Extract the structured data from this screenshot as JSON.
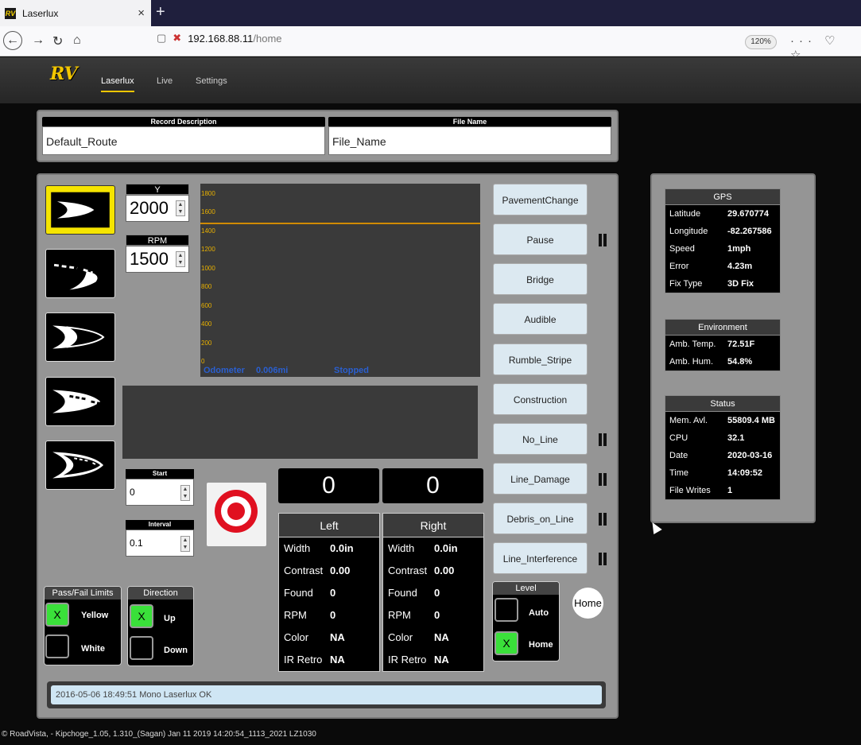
{
  "browser": {
    "tab_title": "Laserlux",
    "tab_close": "×",
    "new_tab": "+",
    "url_host": "192.168.88.11",
    "url_path": "/home",
    "zoom": "120%",
    "more_icon": "···"
  },
  "nav": {
    "logo": "RV",
    "links": [
      "Laserlux",
      "Live",
      "Settings"
    ]
  },
  "record": {
    "desc_label": "Record Description",
    "desc_value": "Default_Route",
    "file_label": "File Name",
    "file_value": "File_Name"
  },
  "controls": {
    "y_label": "Y",
    "y_value": "2000",
    "rpm_label": "RPM",
    "rpm_value": "1500",
    "start_label": "Start",
    "start_value": "0",
    "interval_label": "Interval",
    "interval_value": "0.1"
  },
  "chart_data": {
    "type": "line",
    "yticks": [
      "1800",
      "1600",
      "1400",
      "1200",
      "1000",
      "800",
      "600",
      "400",
      "200",
      "0"
    ],
    "ylim": [
      0,
      1800
    ],
    "threshold": 1500,
    "odometer_label": "Odometer",
    "odometer_value": "0.006mi",
    "state": "Stopped"
  },
  "counts": {
    "left": "0",
    "right": "0"
  },
  "left_stats": {
    "title": "Left",
    "rows": [
      {
        "k": "Width",
        "v": "0.0in"
      },
      {
        "k": "Contrast",
        "v": "0.00"
      },
      {
        "k": "Found",
        "v": "0"
      },
      {
        "k": "RPM",
        "v": "0"
      },
      {
        "k": "Color",
        "v": "NA"
      },
      {
        "k": "IR Retro",
        "v": "NA"
      }
    ]
  },
  "right_stats": {
    "title": "Right",
    "rows": [
      {
        "k": "Width",
        "v": "0.0in"
      },
      {
        "k": "Contrast",
        "v": "0.00"
      },
      {
        "k": "Found",
        "v": "0"
      },
      {
        "k": "RPM",
        "v": "0"
      },
      {
        "k": "Color",
        "v": "NA"
      },
      {
        "k": "IR Retro",
        "v": "NA"
      }
    ]
  },
  "events": [
    "PavementChange",
    "Pause",
    "Bridge",
    "Audible",
    "Rumble_Stripe",
    "Construction",
    "No_Line",
    "Line_Damage",
    "Debris_on_Line",
    "Line_Interference"
  ],
  "passfail": {
    "title": "Pass/Fail Limits",
    "yellow": "Yellow",
    "white": "White",
    "check": "X"
  },
  "direction": {
    "title": "Direction",
    "up": "Up",
    "down": "Down",
    "check": "X"
  },
  "level": {
    "title": "Level",
    "auto": "Auto",
    "home": "Home",
    "check": "X"
  },
  "home_button": "Home",
  "status_message": "2016-05-06 18:49:51 Mono Laserlux OK",
  "footer": "© RoadVista, - Kipchoge_1.05, 1.310_(Sagan) Jan 11 2019 14:20:54_1113_2021 LZ1030",
  "gps": {
    "title": "GPS",
    "rows": [
      {
        "k": "Latitude",
        "v": "29.670774"
      },
      {
        "k": "Longitude",
        "v": "-82.267586"
      },
      {
        "k": "Speed",
        "v": "1mph"
      },
      {
        "k": "Error",
        "v": "4.23m"
      },
      {
        "k": "Fix Type",
        "v": "3D Fix"
      }
    ]
  },
  "environment": {
    "title": "Environment",
    "rows": [
      {
        "k": "Amb. Temp.",
        "v": "72.51F"
      },
      {
        "k": "Amb. Hum.",
        "v": "54.8%"
      }
    ]
  },
  "status": {
    "title": "Status",
    "rows": [
      {
        "k": "Mem. Avl.",
        "v": "55809.4 MB"
      },
      {
        "k": "CPU",
        "v": "32.1"
      },
      {
        "k": "Date",
        "v": "2020-03-16"
      },
      {
        "k": "Time",
        "v": "14:09:52"
      },
      {
        "k": "File Writes",
        "v": "1"
      }
    ]
  },
  "colors": {
    "accent": "#f5e400",
    "check_on": "#3ae03a",
    "chart_line": "#d08a00"
  }
}
